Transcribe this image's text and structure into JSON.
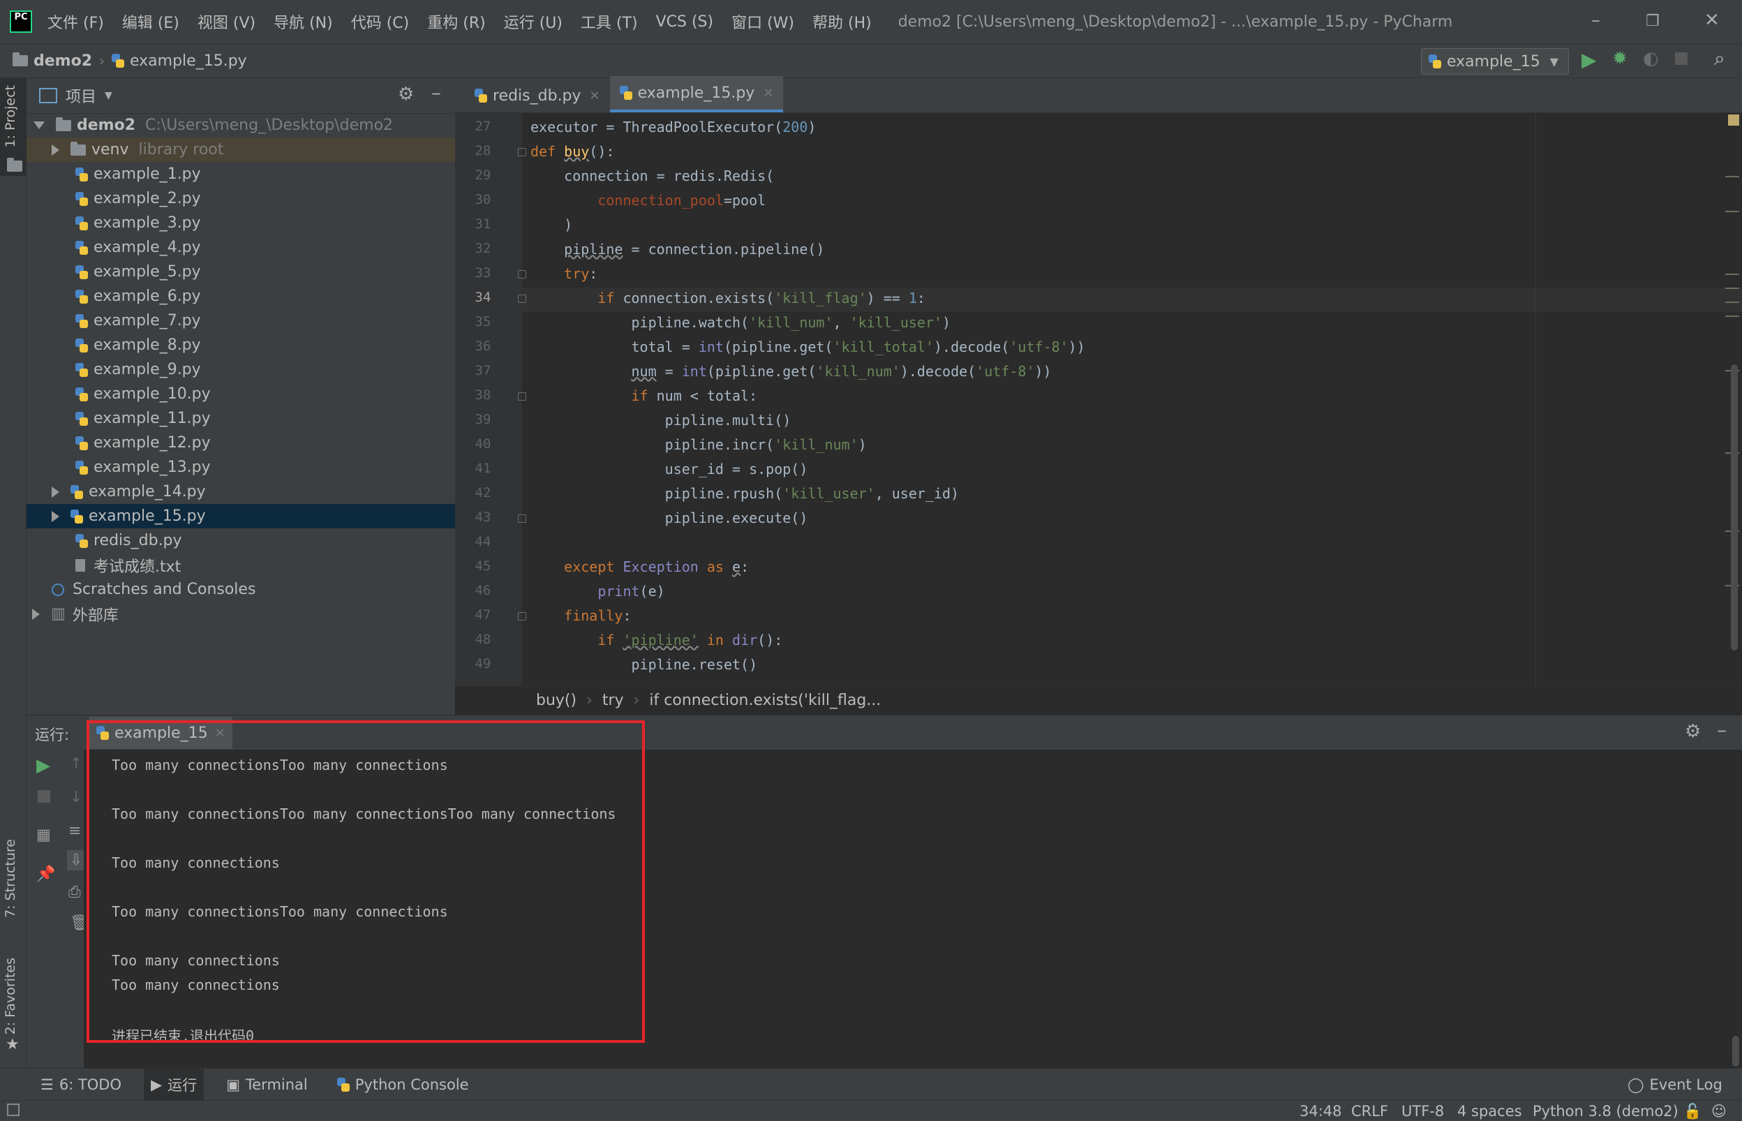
{
  "menubar": {
    "items": [
      "文件 (F)",
      "编辑 (E)",
      "视图 (V)",
      "导航 (N)",
      "代码 (C)",
      "重构 (R)",
      "运行 (U)",
      "工具 (T)",
      "VCS (S)",
      "窗口 (W)",
      "帮助 (H)"
    ],
    "window_title": "demo2 [C:\\Users\\meng_\\Desktop\\demo2] - ...\\example_15.py - PyCharm"
  },
  "navbar": {
    "project": "demo2",
    "file": "example_15.py",
    "run_config": "example_15"
  },
  "leftstrip": {
    "project_tab": "1: Project",
    "structure_tab": "7: Structure",
    "favorites_tab": "2: Favorites"
  },
  "project_panel": {
    "title": "项目",
    "root_name": "demo2",
    "root_path": "C:\\Users\\meng_\\Desktop\\demo2",
    "venv_name": "venv",
    "venv_label": "library root",
    "files": [
      "example_1.py",
      "example_2.py",
      "example_3.py",
      "example_4.py",
      "example_5.py",
      "example_6.py",
      "example_7.py",
      "example_8.py",
      "example_9.py",
      "example_10.py",
      "example_11.py",
      "example_12.py",
      "example_13.py",
      "example_14.py",
      "example_15.py",
      "redis_db.py",
      "考试成绩.txt"
    ],
    "scratches": "Scratches and Consoles",
    "external": "外部库"
  },
  "editor": {
    "tabs": [
      "redis_db.py",
      "example_15.py"
    ],
    "line_numbers": [
      "27",
      "28",
      "29",
      "30",
      "31",
      "32",
      "33",
      "34",
      "35",
      "36",
      "37",
      "38",
      "39",
      "40",
      "41",
      "42",
      "43",
      "44",
      "45",
      "46",
      "47",
      "48",
      "49"
    ],
    "current_line": "34",
    "breadcrumbs": [
      "buy()",
      "try",
      "if connection.exists('kill_flag..."
    ]
  },
  "run_panel": {
    "label": "运行:",
    "tab": "example_15",
    "output": [
      "Too many connectionsToo many connections",
      "",
      "Too many connectionsToo many connectionsToo many connections",
      "",
      "Too many connections",
      "",
      "Too many connectionsToo many connections",
      "",
      "Too many connections",
      "Too many connections",
      "",
      "进程已结束,退出代码0"
    ],
    "highlight_color": "#e5252a"
  },
  "bottom_tabs": [
    "6: TODO",
    "运行",
    "Terminal",
    "Python Console"
  ],
  "event_log": "Event Log",
  "statusbar": {
    "position": "34:48",
    "line_sep": "CRLF",
    "encoding": "UTF-8",
    "indent": "4 spaces",
    "interpreter": "Python 3.8 (demo2)"
  }
}
